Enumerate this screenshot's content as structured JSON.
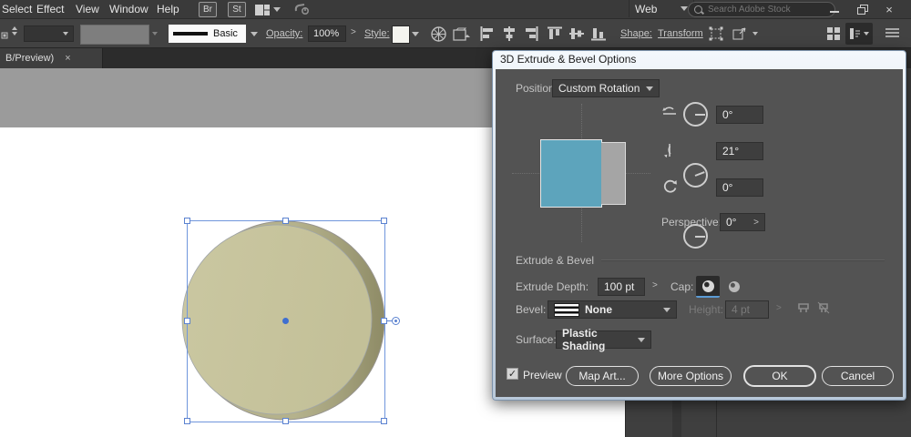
{
  "icons": {
    "close": "×",
    "chevron_right": ">",
    "check": "✓"
  },
  "menubar": {
    "items": [
      "Select",
      "Effect",
      "View",
      "Window",
      "Help"
    ],
    "br_badge": "Br",
    "st_badge": "St",
    "workspace_value": "Web",
    "search_placeholder": "Search Adobe Stock"
  },
  "controlbar": {
    "stroke_name": "Basic",
    "opacity_label": "Opacity:",
    "opacity_value": "100%",
    "style_label": "Style:",
    "shape_label": "Shape:",
    "transform_label": "Transform"
  },
  "tabbar": {
    "title": "B/Preview)"
  },
  "dialog": {
    "title": "3D Extrude & Bevel Options",
    "position_label": "Position:",
    "position_value": "Custom Rotation",
    "rotations": [
      {
        "name": "rotate-x",
        "value": "0°",
        "angle": 0
      },
      {
        "name": "rotate-y",
        "value": "21°",
        "angle": 21
      },
      {
        "name": "rotate-z",
        "value": "0°",
        "angle": 0
      }
    ],
    "perspective_label": "Perspective:",
    "perspective_value": "0°",
    "section_title": "Extrude & Bevel",
    "extrude_depth_label": "Extrude Depth:",
    "extrude_depth_value": "100 pt",
    "cap_label": "Cap:",
    "bevel_label": "Bevel:",
    "bevel_value": "None",
    "height_label": "Height:",
    "height_value": "4 pt",
    "surface_label": "Surface:",
    "surface_value": "Plastic Shading",
    "preview_label": "Preview",
    "map_art_label": "Map Art...",
    "more_options_label": "More Options",
    "ok_label": "OK",
    "cancel_label": "Cancel"
  },
  "canvas": {
    "selection_color": "#5b82d0",
    "artwork": {
      "face_color": "#c8c59f",
      "extrude_mid": "#b5b28c",
      "extrude_dark": "#8e8b66"
    },
    "cube_preview": {
      "front_color": "#5da4bc",
      "side_color": "#a5a5a5"
    }
  }
}
